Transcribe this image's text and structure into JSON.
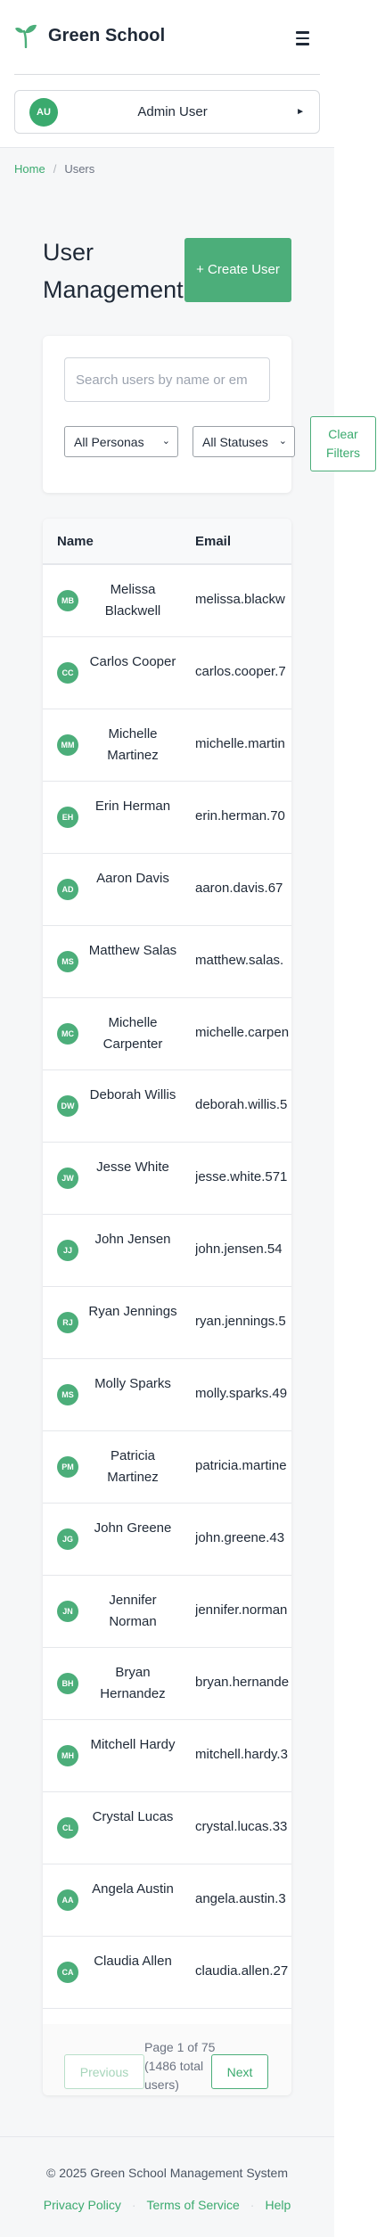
{
  "header": {
    "brand_name": "Green School",
    "user": {
      "initials": "AU",
      "name": "Admin User"
    }
  },
  "breadcrumb": {
    "home": "Home",
    "current": "Users"
  },
  "page": {
    "title": "User Management",
    "create_label": "+ Create User"
  },
  "filters": {
    "search_placeholder": "Search users by name or em",
    "persona_selected": "All Personas",
    "status_selected": "All Statuses",
    "clear_label": "Clear Filters"
  },
  "table": {
    "columns": [
      "Name",
      "Email"
    ],
    "rows": [
      {
        "initials": "MB",
        "name": "Melissa Blackwell",
        "email": "melissa.blackw"
      },
      {
        "initials": "CC",
        "name": "Carlos Cooper",
        "email": "carlos.cooper.7"
      },
      {
        "initials": "MM",
        "name": "Michelle Martinez",
        "email": "michelle.martin"
      },
      {
        "initials": "EH",
        "name": "Erin Herman",
        "email": "erin.herman.70"
      },
      {
        "initials": "AD",
        "name": "Aaron Davis",
        "email": "aaron.davis.67"
      },
      {
        "initials": "MS",
        "name": "Matthew Salas",
        "email": "matthew.salas."
      },
      {
        "initials": "MC",
        "name": "Michelle Carpenter",
        "email": "michelle.carpen"
      },
      {
        "initials": "DW",
        "name": "Deborah Willis",
        "email": "deborah.willis.5"
      },
      {
        "initials": "JW",
        "name": "Jesse White",
        "email": "jesse.white.571"
      },
      {
        "initials": "JJ",
        "name": "John Jensen",
        "email": "john.jensen.54"
      },
      {
        "initials": "RJ",
        "name": "Ryan Jennings",
        "email": "ryan.jennings.5"
      },
      {
        "initials": "MS",
        "name": "Molly Sparks",
        "email": "molly.sparks.49"
      },
      {
        "initials": "PM",
        "name": "Patricia Martinez",
        "email": "patricia.martine"
      },
      {
        "initials": "JG",
        "name": "John Greene",
        "email": "john.greene.43"
      },
      {
        "initials": "JN",
        "name": "Jennifer Norman",
        "email": "jennifer.norman"
      },
      {
        "initials": "BH",
        "name": "Bryan Hernandez",
        "email": "bryan.hernande"
      },
      {
        "initials": "MH",
        "name": "Mitchell Hardy",
        "email": "mitchell.hardy.3"
      },
      {
        "initials": "CL",
        "name": "Crystal Lucas",
        "email": "crystal.lucas.33"
      },
      {
        "initials": "AA",
        "name": "Angela Austin",
        "email": "angela.austin.3"
      },
      {
        "initials": "CA",
        "name": "Claudia Allen",
        "email": "claudia.allen.27"
      }
    ]
  },
  "pagination": {
    "prev_label": "Previous",
    "info": "Page 1 of 75 (1486 total users)",
    "next_label": "Next"
  },
  "footer": {
    "copyright": "© 2025 Green School Management System",
    "links": [
      "Privacy Policy",
      "Terms of Service",
      "Help"
    ]
  },
  "icons": {
    "brand": "leaf-icon",
    "menu": "hamburger-menu-icon",
    "user_caret": "caret-right-icon",
    "select_chevron": "chevron-down-icon"
  },
  "colors": {
    "accent": "#4cae7a",
    "accent_text": "#3aaa6e",
    "text": "#1f2937",
    "muted": "#6b7280"
  }
}
